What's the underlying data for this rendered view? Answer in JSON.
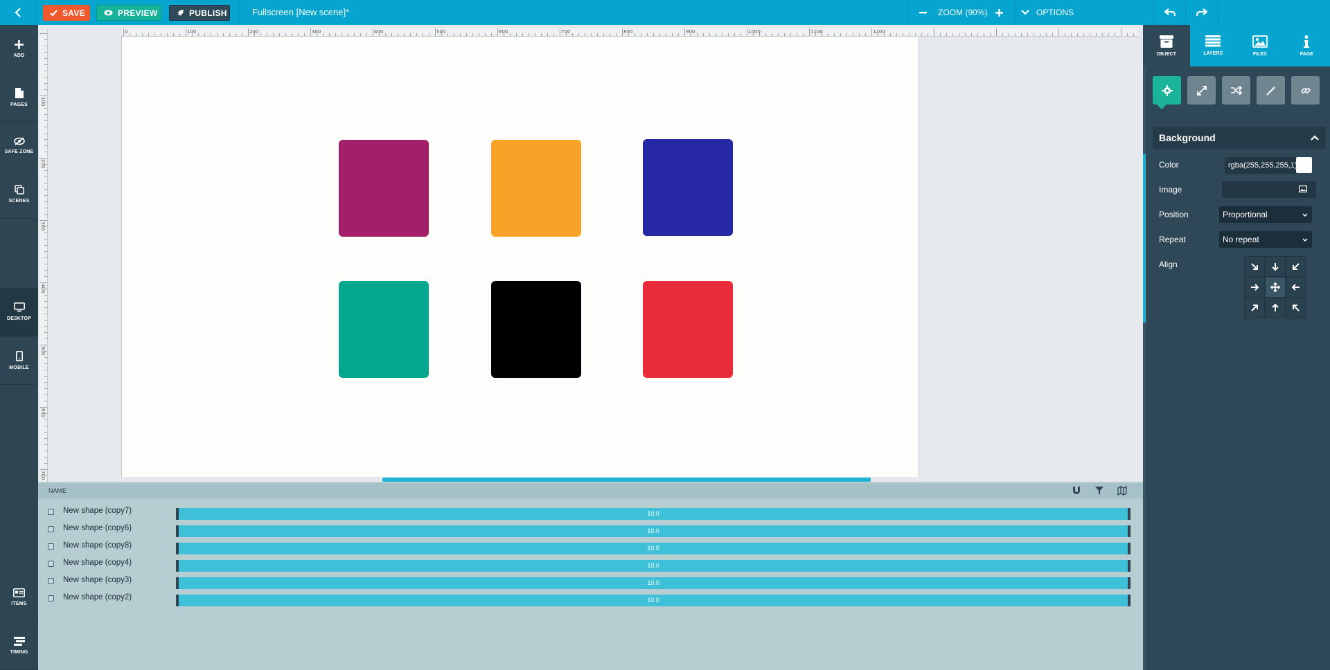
{
  "topbar": {
    "save_label": "SAVE",
    "preview_label": "PREVIEW",
    "publish_label": "PUBLISH",
    "document_title": "Fullscreen [New scene]*",
    "zoom_label": "ZOOM (90%)",
    "options_label": "OPTIONS"
  },
  "leftbar": {
    "items": [
      {
        "label": "ADD",
        "icon": "plus-icon"
      },
      {
        "label": "PAGES",
        "icon": "page-icon"
      },
      {
        "label": "SAFE ZONE",
        "icon": "eye-slash-icon"
      },
      {
        "label": "SCENES",
        "icon": "scenes-icon"
      },
      {
        "label": "DESKTOP",
        "icon": "desktop-icon",
        "active": true
      },
      {
        "label": "MOBILE",
        "icon": "mobile-icon"
      },
      {
        "label": "ITEMS",
        "icon": "items-icon"
      },
      {
        "label": "TIMING",
        "icon": "timing-icon"
      }
    ]
  },
  "canvas": {
    "ruler_h_ticks": [
      "0",
      "100",
      "200",
      "300",
      "400",
      "500",
      "600",
      "700",
      "800",
      "900",
      "1000",
      "1100",
      "1200"
    ],
    "ruler_v_ticks": [
      "100",
      "200",
      "300",
      "400",
      "500",
      "600",
      "700"
    ],
    "shape_colors": [
      "#a41f6a",
      "#f8a327",
      "#2728a3",
      "#05a88f",
      "#000000",
      "#e92c3c"
    ]
  },
  "rightpanel": {
    "tabs": [
      {
        "label": "OBJECT",
        "icon": "archive-icon",
        "active": true
      },
      {
        "label": "LAYERS",
        "icon": "layers-icon"
      },
      {
        "label": "FILES",
        "icon": "image-icon"
      },
      {
        "label": "PAGE",
        "icon": "info-icon"
      }
    ],
    "tools": [
      "gear-icon",
      "expand-icon",
      "shuffle-icon",
      "magic-wand-icon",
      "link-icon"
    ],
    "section_title": "Background",
    "color_label": "Color",
    "color_value": "rgba(255,255,255,1)",
    "image_label": "Image",
    "image_value": "",
    "position_label": "Position",
    "position_value": "Proportional",
    "repeat_label": "Repeat",
    "repeat_value": "No repeat",
    "align_label": "Align"
  },
  "timeline": {
    "name_header": "NAME",
    "rows": [
      {
        "name": "New shape (copy7)",
        "value": "10.0"
      },
      {
        "name": "New shape (copy6)",
        "value": "10.0"
      },
      {
        "name": "New shape (copy8)",
        "value": "10.0"
      },
      {
        "name": "New shape (copy4)",
        "value": "10.0"
      },
      {
        "name": "New shape (copy3)",
        "value": "10.0"
      },
      {
        "name": "New shape (copy2)",
        "value": "10.0"
      }
    ]
  },
  "colors": {
    "topbar": "#05a5cf",
    "sidebar": "#2e4553",
    "save": "#f0592e",
    "preview": "#14b39a",
    "publish": "#2f4a5a"
  }
}
